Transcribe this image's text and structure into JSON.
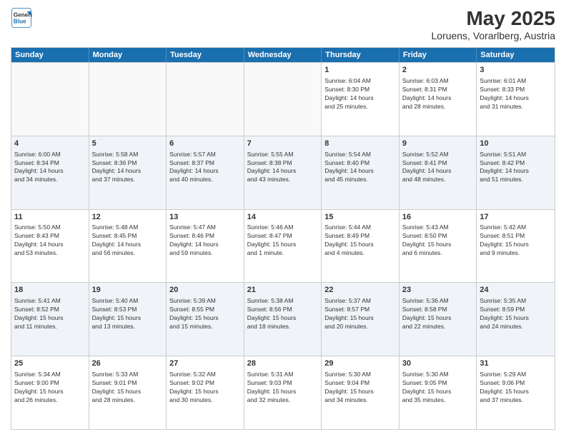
{
  "header": {
    "logo_line1": "General",
    "logo_line2": "Blue",
    "month_year": "May 2025",
    "location": "Loruens, Vorarlberg, Austria"
  },
  "weekdays": [
    "Sunday",
    "Monday",
    "Tuesday",
    "Wednesday",
    "Thursday",
    "Friday",
    "Saturday"
  ],
  "rows": [
    [
      {
        "day": "",
        "info": "",
        "empty": true
      },
      {
        "day": "",
        "info": "",
        "empty": true
      },
      {
        "day": "",
        "info": "",
        "empty": true
      },
      {
        "day": "",
        "info": "",
        "empty": true
      },
      {
        "day": "1",
        "info": "Sunrise: 6:04 AM\nSunset: 8:30 PM\nDaylight: 14 hours\nand 25 minutes.",
        "empty": false
      },
      {
        "day": "2",
        "info": "Sunrise: 6:03 AM\nSunset: 8:31 PM\nDaylight: 14 hours\nand 28 minutes.",
        "empty": false
      },
      {
        "day": "3",
        "info": "Sunrise: 6:01 AM\nSunset: 8:33 PM\nDaylight: 14 hours\nand 31 minutes.",
        "empty": false
      }
    ],
    [
      {
        "day": "4",
        "info": "Sunrise: 6:00 AM\nSunset: 8:34 PM\nDaylight: 14 hours\nand 34 minutes.",
        "empty": false
      },
      {
        "day": "5",
        "info": "Sunrise: 5:58 AM\nSunset: 8:36 PM\nDaylight: 14 hours\nand 37 minutes.",
        "empty": false
      },
      {
        "day": "6",
        "info": "Sunrise: 5:57 AM\nSunset: 8:37 PM\nDaylight: 14 hours\nand 40 minutes.",
        "empty": false
      },
      {
        "day": "7",
        "info": "Sunrise: 5:55 AM\nSunset: 8:38 PM\nDaylight: 14 hours\nand 43 minutes.",
        "empty": false
      },
      {
        "day": "8",
        "info": "Sunrise: 5:54 AM\nSunset: 8:40 PM\nDaylight: 14 hours\nand 45 minutes.",
        "empty": false
      },
      {
        "day": "9",
        "info": "Sunrise: 5:52 AM\nSunset: 8:41 PM\nDaylight: 14 hours\nand 48 minutes.",
        "empty": false
      },
      {
        "day": "10",
        "info": "Sunrise: 5:51 AM\nSunset: 8:42 PM\nDaylight: 14 hours\nand 51 minutes.",
        "empty": false
      }
    ],
    [
      {
        "day": "11",
        "info": "Sunrise: 5:50 AM\nSunset: 8:43 PM\nDaylight: 14 hours\nand 53 minutes.",
        "empty": false
      },
      {
        "day": "12",
        "info": "Sunrise: 5:48 AM\nSunset: 8:45 PM\nDaylight: 14 hours\nand 56 minutes.",
        "empty": false
      },
      {
        "day": "13",
        "info": "Sunrise: 5:47 AM\nSunset: 8:46 PM\nDaylight: 14 hours\nand 59 minutes.",
        "empty": false
      },
      {
        "day": "14",
        "info": "Sunrise: 5:46 AM\nSunset: 8:47 PM\nDaylight: 15 hours\nand 1 minute.",
        "empty": false
      },
      {
        "day": "15",
        "info": "Sunrise: 5:44 AM\nSunset: 8:49 PM\nDaylight: 15 hours\nand 4 minutes.",
        "empty": false
      },
      {
        "day": "16",
        "info": "Sunrise: 5:43 AM\nSunset: 8:50 PM\nDaylight: 15 hours\nand 6 minutes.",
        "empty": false
      },
      {
        "day": "17",
        "info": "Sunrise: 5:42 AM\nSunset: 8:51 PM\nDaylight: 15 hours\nand 9 minutes.",
        "empty": false
      }
    ],
    [
      {
        "day": "18",
        "info": "Sunrise: 5:41 AM\nSunset: 8:52 PM\nDaylight: 15 hours\nand 11 minutes.",
        "empty": false
      },
      {
        "day": "19",
        "info": "Sunrise: 5:40 AM\nSunset: 8:53 PM\nDaylight: 15 hours\nand 13 minutes.",
        "empty": false
      },
      {
        "day": "20",
        "info": "Sunrise: 5:39 AM\nSunset: 8:55 PM\nDaylight: 15 hours\nand 15 minutes.",
        "empty": false
      },
      {
        "day": "21",
        "info": "Sunrise: 5:38 AM\nSunset: 8:56 PM\nDaylight: 15 hours\nand 18 minutes.",
        "empty": false
      },
      {
        "day": "22",
        "info": "Sunrise: 5:37 AM\nSunset: 8:57 PM\nDaylight: 15 hours\nand 20 minutes.",
        "empty": false
      },
      {
        "day": "23",
        "info": "Sunrise: 5:36 AM\nSunset: 8:58 PM\nDaylight: 15 hours\nand 22 minutes.",
        "empty": false
      },
      {
        "day": "24",
        "info": "Sunrise: 5:35 AM\nSunset: 8:59 PM\nDaylight: 15 hours\nand 24 minutes.",
        "empty": false
      }
    ],
    [
      {
        "day": "25",
        "info": "Sunrise: 5:34 AM\nSunset: 9:00 PM\nDaylight: 15 hours\nand 26 minutes.",
        "empty": false
      },
      {
        "day": "26",
        "info": "Sunrise: 5:33 AM\nSunset: 9:01 PM\nDaylight: 15 hours\nand 28 minutes.",
        "empty": false
      },
      {
        "day": "27",
        "info": "Sunrise: 5:32 AM\nSunset: 9:02 PM\nDaylight: 15 hours\nand 30 minutes.",
        "empty": false
      },
      {
        "day": "28",
        "info": "Sunrise: 5:31 AM\nSunset: 9:03 PM\nDaylight: 15 hours\nand 32 minutes.",
        "empty": false
      },
      {
        "day": "29",
        "info": "Sunrise: 5:30 AM\nSunset: 9:04 PM\nDaylight: 15 hours\nand 34 minutes.",
        "empty": false
      },
      {
        "day": "30",
        "info": "Sunrise: 5:30 AM\nSunset: 9:05 PM\nDaylight: 15 hours\nand 35 minutes.",
        "empty": false
      },
      {
        "day": "31",
        "info": "Sunrise: 5:29 AM\nSunset: 9:06 PM\nDaylight: 15 hours\nand 37 minutes.",
        "empty": false
      }
    ]
  ]
}
